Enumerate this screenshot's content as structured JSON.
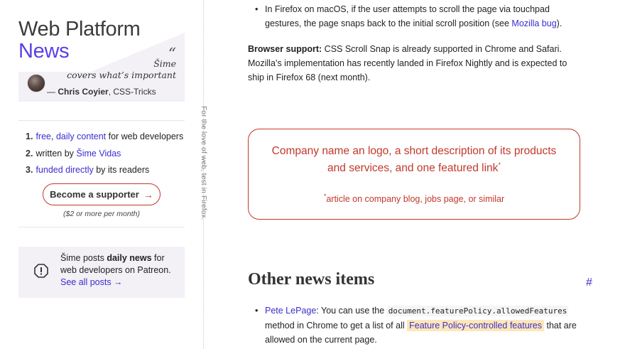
{
  "sidebar": {
    "title_line1": "Web Platform",
    "title_line2": "News",
    "quote_mark": "“",
    "quote_line1": "Šime",
    "quote_line2": "covers what’s important",
    "quote_dash": "— ",
    "quote_author": "Chris Coyier",
    "quote_source": ", CSS-Tricks",
    "features": [
      {
        "num": "1.",
        "link1": "free",
        "sep": ", ",
        "link2": "daily content",
        "tail": " for web developers"
      },
      {
        "num": "2.",
        "pre": "written by ",
        "link": "Šime Vidas"
      },
      {
        "num": "3.",
        "link": "funded directly",
        "tail": " by its readers"
      }
    ],
    "supporter_label": "Become a supporter",
    "supporter_arrow": "→",
    "supporter_note": "($2 or more per month)",
    "patreon_pre": "Šime posts ",
    "patreon_bold": "daily news",
    "patreon_post": " for web developers on Patreon.",
    "patreon_link": "See all posts →"
  },
  "vertical_text": "For the love of web, test in Firefox.",
  "main": {
    "bullet1_text": "In Firefox on macOS, if the user attempts to scroll the page via touchpad gestures, the page snaps back to the initial scroll position (see ",
    "bullet1_link": "Mozilla bug",
    "bullet1_end": ").",
    "support_label": "Browser support:",
    "support_text": " CSS Scroll Snap is already supported in Chrome and Safari. Mozilla’s implementation has recently landed in Firefox Nightly and is expected to ship in Firefox 68 (next month).",
    "sponsor_big": "Company name an logo, a short description of its products and services, and one featured link",
    "sponsor_star": "*",
    "sponsor_small": "article on company blog, jobs page, or similar",
    "news_heading": "Other news items",
    "hash": "#",
    "news1_link": "Pete LePage",
    "news1_text1": ": You can use the ",
    "news1_code": "document.featurePolicy.allowedFeatures",
    "news1_text2": " method in Chrome to get a list of all ",
    "news1_highlight": "Feature Policy-controlled features",
    "news1_text3": " that are allowed on the current page."
  },
  "colors": {
    "accent": "#5c3ee8",
    "link": "#3b2ecf",
    "sponsor_red": "#c0392b",
    "highlight": "#fde7b9",
    "patreon_bg": "#f3f0f6"
  },
  "icons": [
    "patreon-alert-icon",
    "arrow-right-icon",
    "avatar"
  ]
}
